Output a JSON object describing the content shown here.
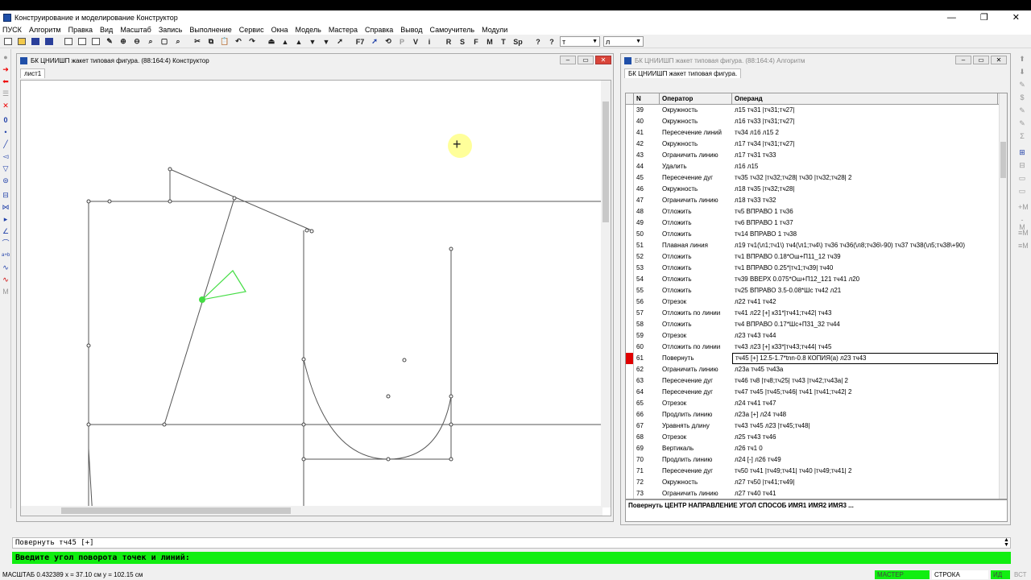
{
  "app": {
    "title": "Конструирование и моделирование  Конструктор"
  },
  "menu": [
    "ПУСК",
    "Алгоритм",
    "Правка",
    "Вид",
    "Масштаб",
    "Запись",
    "Выполнение",
    "Сервис",
    "Окна",
    "Модель",
    "Мастера",
    "Справка",
    "Вывод",
    "Самоучитель",
    "Модули"
  ],
  "toolbar": {
    "text_buttons": [
      "F7",
      "P",
      "V",
      "i",
      "R",
      "S",
      "F",
      "M",
      "T",
      "Sp"
    ],
    "combo1": "т",
    "combo2": "л"
  },
  "constructor": {
    "title": "БК ЦНИИШП жакет типовая фигура. (88:164:4) Конструктор",
    "tab": "лист1"
  },
  "algorithm": {
    "title": "БК ЦНИИШП жакет типовая фигура. (88:164:4) Алгоритм",
    "tab": "БК ЦНИИШП жакет типовая фигура.",
    "columns": [
      "N",
      "Оператор",
      "Операнд"
    ],
    "rows": [
      {
        "n": "39",
        "op": "Окружность",
        "arg": "л15 тч31 |тч31;тч27|"
      },
      {
        "n": "40",
        "op": "Окружность",
        "arg": "л16 тч33 |тч31;тч27|"
      },
      {
        "n": "41",
        "op": "Пересечение линий",
        "arg": "тч34 л16 л15 2"
      },
      {
        "n": "42",
        "op": "Окружность",
        "arg": "л17 тч34 |тч31;тч27|"
      },
      {
        "n": "43",
        "op": "Ограничить линию",
        "arg": "л17 тч31 тч33"
      },
      {
        "n": "44",
        "op": "Удалить",
        "arg": "л16 л15"
      },
      {
        "n": "45",
        "op": "Пересечение дуг",
        "arg": "тч35 тч32 |тч32;тч28| тч30 |тч32;тч28| 2"
      },
      {
        "n": "46",
        "op": "Окружность",
        "arg": "л18 тч35 |тч32;тч28|"
      },
      {
        "n": "47",
        "op": "Ограничить линию",
        "arg": "л18 тч33 тч32"
      },
      {
        "n": "48",
        "op": "Отложить",
        "arg": "тч5 ВПРАВО 1 тч36"
      },
      {
        "n": "49",
        "op": "Отложить",
        "arg": "тч6 ВПРАВО 1 тч37"
      },
      {
        "n": "50",
        "op": "Отложить",
        "arg": "тч14 ВПРАВО 1 тч38"
      },
      {
        "n": "51",
        "op": "Плавная линия",
        "arg": "л19 тч1(\\л1;тч1\\) тч4(\\л1;тч4\\) тч36 тч36(\\л8;тч36\\-90) тч37 тч38(\\л5;тч38\\+90)"
      },
      {
        "n": "52",
        "op": "Отложить",
        "arg": "тч1 ВПРАВО 0.18*Ош+П11_12 тч39"
      },
      {
        "n": "53",
        "op": "Отложить",
        "arg": "тч1 ВПРАВО 0.25*|тч1;тч39| тч40"
      },
      {
        "n": "54",
        "op": "Отложить",
        "arg": "тч39 ВВЕРХ 0.075*Ош+П12_121 тч41 л20"
      },
      {
        "n": "55",
        "op": "Отложить",
        "arg": "тч25 ВПРАВО 3.5-0.08*Шс тч42 л21"
      },
      {
        "n": "56",
        "op": "Отрезок",
        "arg": "л22 тч41 тч42"
      },
      {
        "n": "57",
        "op": "Отложить по линии",
        "arg": "тч41 л22 [+] к31*|тч41;тч42| тч43"
      },
      {
        "n": "58",
        "op": "Отложить",
        "arg": "тч4 ВПРАВО 0.17*Шс+П31_32 тч44"
      },
      {
        "n": "59",
        "op": "Отрезок",
        "arg": "л23 тч43 тч44"
      },
      {
        "n": "60",
        "op": "Отложить по линии",
        "arg": "тч43 л23 [+] к33*|тч43;тч44| тч45"
      },
      {
        "n": "61",
        "op": "Повернуть",
        "arg": "тч45 [+] 12.5-1.7*tnn-0.8 КОПИЯ(а) л23 тч43",
        "sel": true
      },
      {
        "n": "62",
        "op": "Ограничить линию",
        "arg": "л23а тч45 тч43а"
      },
      {
        "n": "63",
        "op": "Пересечение дуг",
        "arg": "тч46 тч8 |тч8;тч25| тч43 |тч42;тч43а| 2"
      },
      {
        "n": "64",
        "op": "Пересечение дуг",
        "arg": "тч47 тч45 |тч45;тч46| тч41 |тч41;тч42| 2"
      },
      {
        "n": "65",
        "op": "Отрезок",
        "arg": "л24 тч41 тч47"
      },
      {
        "n": "66",
        "op": "Продлить линию",
        "arg": "л23а [+] л24 тч48"
      },
      {
        "n": "67",
        "op": "Уравнять длину",
        "arg": "тч43 тч45 л23 |тч45;тч48|"
      },
      {
        "n": "68",
        "op": "Отрезок",
        "arg": "л25 тч43 тч46"
      },
      {
        "n": "69",
        "op": "Вертикаль",
        "arg": "л26 тч1 0"
      },
      {
        "n": "70",
        "op": "Продлить линию",
        "arg": "л24 [-] л26 тч49"
      },
      {
        "n": "71",
        "op": "Пересечение дуг",
        "arg": "тч50 тч41 |тч49;тч41| тч40 |тч49;тч41| 2"
      },
      {
        "n": "72",
        "op": "Окружность",
        "arg": "л27 тч50 |тч41;тч49|"
      },
      {
        "n": "73",
        "op": "Ограничить линию",
        "arg": "л27 тч40 тч41"
      }
    ],
    "syntax_hint": "Повернуть ЦЕНТР НАПРАВЛЕНИЕ УГОЛ СПОСОБ ИМЯ1 ИМЯ2 ИМЯ3 ..."
  },
  "command": {
    "line": "Повернуть тч45 [+]",
    "prompt": "Введите угол поворота точек и линий:"
  },
  "status": {
    "left": "МАСШТАБ 0.432389    x = 37.10 см    y = 102.15 см",
    "master": "МАСТЕР",
    "row": "СТРОКА",
    "id": "ИД",
    "vst": "ВСТ"
  }
}
